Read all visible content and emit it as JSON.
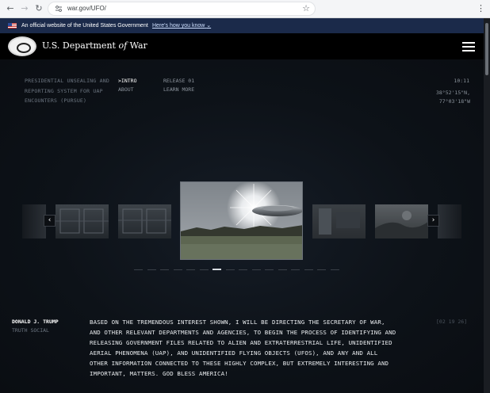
{
  "browser": {
    "url": "war.gov/UFO/",
    "back_icon": "arrow-left-icon",
    "forward_icon": "arrow-right-icon",
    "reload_icon": "reload-icon",
    "star_icon": "star-icon",
    "menu_icon": "kebab-menu-icon"
  },
  "gov_banner": {
    "text": "An official website of the United States Government",
    "link": "Here's how you know"
  },
  "header": {
    "name_pre": "U.S. Department ",
    "name_of": "of",
    "name_post": " War"
  },
  "main": {
    "system_title": "PRESIDENTIAL UNSEALING AND REPORTING SYSTEM FOR UAP ENCOUNTERS (PURSUE)",
    "nav": [
      {
        "label": ">INTRO",
        "active": true
      },
      {
        "label": "ABOUT",
        "active": false
      },
      {
        "label": "RELEASE 01",
        "active": false
      },
      {
        "label": "LEARN MORE",
        "active": false
      }
    ],
    "time": "10:11",
    "coord_lat": "38°52'15\"N,",
    "coord_lon": "77°03'18\"W"
  },
  "carousel": {
    "prev_label": "‹",
    "next_label": "›",
    "slide_count": 16,
    "active_index": 6
  },
  "quote": {
    "author": "DONALD J. TRUMP",
    "source": "TRUTH SOCIAL",
    "text": "BASED ON THE TREMENDOUS INTEREST SHOWN, I WILL BE DIRECTING THE SECRETARY OF WAR, AND OTHER RELEVANT DEPARTMENTS AND AGENCIES, TO BEGIN THE PROCESS OF IDENTIFYING AND RELEASING GOVERNMENT FILES RELATED TO ALIEN AND EXTRATERRESTRIAL LIFE, UNIDENTIFIED AERIAL PHENOMENA (UAP), AND UNIDENTIFIED FLYING OBJECTS (UFOS), AND ANY AND ALL OTHER INFORMATION CONNECTED TO THESE HIGHLY COMPLEX, BUT EXTREMELY INTERESTING AND IMPORTANT, MATTERS. GOD BLESS AMERICA!",
    "stamp": "[02 19 26]"
  },
  "colors": {
    "background": "#0b0f15",
    "gov_banner": "#1b2a4a",
    "header": "#000000",
    "text_primary": "#ffffff",
    "text_muted": "#6c7580"
  }
}
